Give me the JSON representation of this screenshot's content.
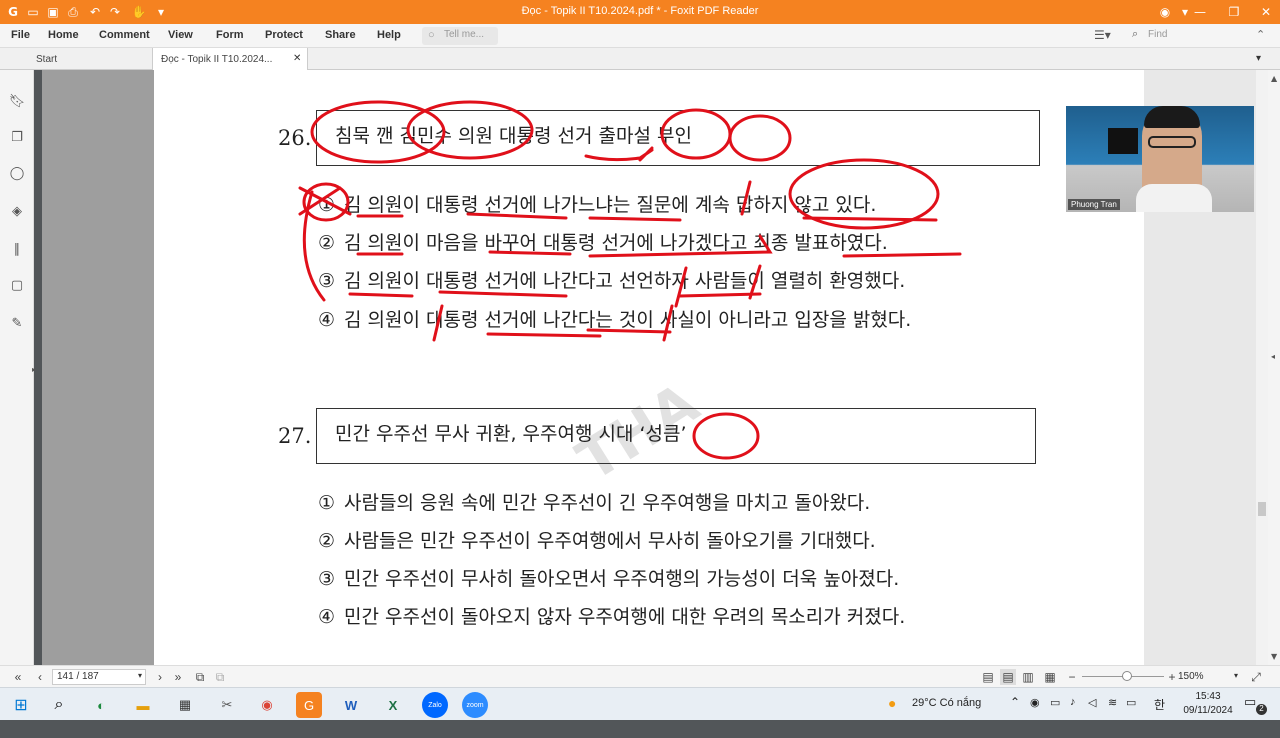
{
  "window": {
    "title": "Đọc  - Topik II T10.2024.pdf * - Foxit PDF Reader"
  },
  "menu": {
    "file": "File",
    "home": "Home",
    "comment": "Comment",
    "view": "View",
    "form": "Form",
    "protect": "Protect",
    "share": "Share",
    "help": "Help",
    "tell_me": "Tell me...",
    "find": "Find"
  },
  "tabs": {
    "start": "Start",
    "doc": "Đọc  - Topik II T10.2024..."
  },
  "questions": [
    {
      "number": "26.",
      "headline": "침묵 깬 김민수 의원 대통령 선거 출마설 부인",
      "options": [
        {
          "mark": "①",
          "text": "김 의원이 대통령 선거에 나가느냐는 질문에 계속 답하지 않고 있다."
        },
        {
          "mark": "②",
          "text": "김 의원이 마음을 바꾸어 대통령 선거에 나가겠다고 최종 발표하였다."
        },
        {
          "mark": "③",
          "text": "김 의원이 대통령 선거에 나간다고 선언하자 사람들이 열렬히 환영했다."
        },
        {
          "mark": "④",
          "text": "김 의원이 대통령 선거에 나간다는 것이 사실이 아니라고 입장을 밝혔다."
        }
      ]
    },
    {
      "number": "27.",
      "headline": "민간 우주선 무사 귀환, 우주여행 시대 ‘성큼’",
      "options": [
        {
          "mark": "①",
          "text": "사람들의 응원 속에 민간 우주선이 긴 우주여행을 마치고 돌아왔다."
        },
        {
          "mark": "②",
          "text": "사람들은 민간 우주선이 우주여행에서 무사히 돌아오기를 기대했다."
        },
        {
          "mark": "③",
          "text": "민간 우주선이 무사히 돌아오면서 우주여행의 가능성이 더욱 높아졌다."
        },
        {
          "mark": "④",
          "text": "민간 우주선이 돌아오지 않자 우주여행에 대한 우려의 목소리가 커졌다."
        }
      ]
    }
  ],
  "watermark": "THA",
  "webcam": {
    "name": "Phuong Tran"
  },
  "status": {
    "page": "141 / 187",
    "zoom": "150%"
  },
  "taskbar": {
    "weather": "29°C  Có nắng",
    "time": "15:43",
    "date": "09/11/2024",
    "notifications": "2"
  },
  "colors": {
    "titlebar": "#f58220",
    "ink": "#e0101a"
  }
}
